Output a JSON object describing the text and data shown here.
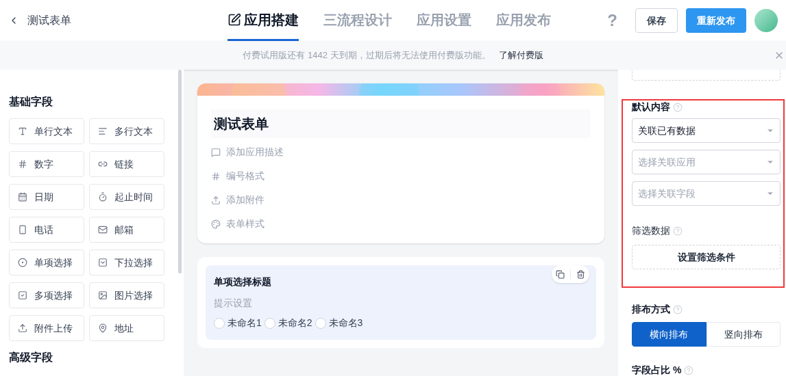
{
  "header": {
    "back_title": "测试表单",
    "tabs": [
      {
        "label": "应用搭建",
        "selected": true
      },
      {
        "label": "三流程设计",
        "selected": false
      },
      {
        "label": "应用设置",
        "selected": false
      },
      {
        "label": "应用发布",
        "selected": false
      }
    ],
    "help": "?",
    "save": "保存",
    "publish": "重新发布"
  },
  "notice": {
    "text": "付费试用版还有 1442 天到期，过期后将无法使用付费版功能。",
    "link": "了解付费版"
  },
  "sidebar": {
    "sections": [
      {
        "title": "基础字段",
        "fields": [
          "单行文本",
          "多行文本",
          "数字",
          "链接",
          "日期",
          "起止时间",
          "电话",
          "邮箱",
          "单项选择",
          "下拉选择",
          "多项选择",
          "图片选择",
          "附件上传",
          "地址"
        ]
      },
      {
        "title": "高级字段"
      }
    ]
  },
  "form": {
    "title": "测试表单",
    "items": [
      "添加应用描述",
      "编号格式",
      "添加附件",
      "表单样式"
    ],
    "question": {
      "title": "单项选择标题",
      "hint": "提示设置",
      "options": [
        {
          "label": "未命名1",
          "selected": false
        },
        {
          "label": "未命名2",
          "selected": false
        },
        {
          "label": "未命名3",
          "selected": false
        }
      ]
    }
  },
  "settings": {
    "default_label": "默认内容",
    "selects": [
      {
        "value": "关联已有数据"
      },
      {
        "placeholder": "选择关联应用"
      },
      {
        "placeholder": "选择关联字段"
      }
    ],
    "filter_label": "筛选数据",
    "filter_button": "设置筛选条件",
    "layout_label": "排布方式",
    "layout_options": [
      {
        "label": "横向排布",
        "selected": true
      },
      {
        "label": "竖向排布",
        "selected": false
      }
    ],
    "ratio_label": "字段占比 %"
  }
}
